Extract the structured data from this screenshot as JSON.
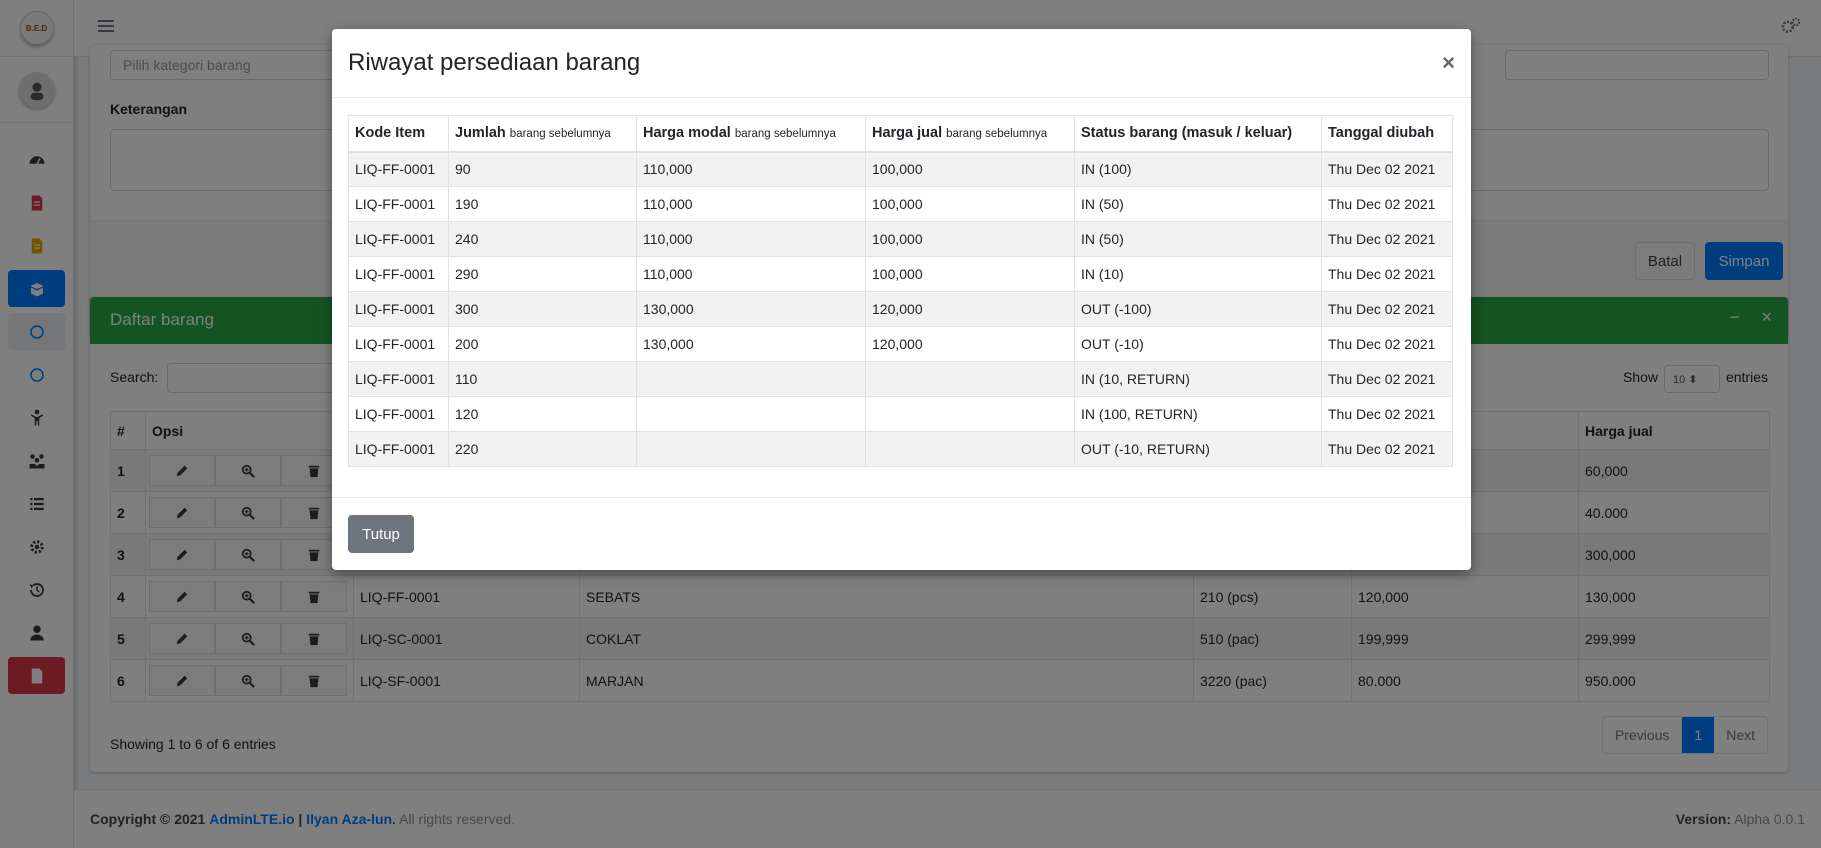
{
  "brand": {
    "logo_text": "B.E.D"
  },
  "header": {
    "menu_icon": "bars-icon",
    "settings_icon": "cogs-icon"
  },
  "form": {
    "category_placeholder": "Pilih kategori barang",
    "keterangan_label": "Keterangan",
    "batal_label": "Batal",
    "simpan_label": "Simpan"
  },
  "list_card": {
    "title": "Daftar barang",
    "search_label": "Search:",
    "show_label": "Show",
    "page_size": "10",
    "entries_label": "entries",
    "col_no": "#",
    "col_opsi": "Opsi",
    "col_harga_jual": "Harga jual",
    "rows": [
      {
        "no": "1",
        "code": "",
        "name": "",
        "stock": "",
        "modal": "",
        "jual": "60,000"
      },
      {
        "no": "2",
        "code": "",
        "name": "",
        "stock": "",
        "modal": "",
        "jual": "40.000"
      },
      {
        "no": "3",
        "code": "",
        "name": "",
        "stock": "",
        "modal": "",
        "jual": "300,000"
      },
      {
        "no": "4",
        "code": "LIQ-FF-0001",
        "name": "SEBATS",
        "stock": "210 (pcs)",
        "modal": "120,000",
        "jual": "130,000"
      },
      {
        "no": "5",
        "code": "LIQ-SC-0001",
        "name": "COKLAT",
        "stock": "510 (pac)",
        "modal": "199,999",
        "jual": "299,999"
      },
      {
        "no": "6",
        "code": "LIQ-SF-0001",
        "name": "MARJAN",
        "stock": "3220 (pac)",
        "modal": "80.000",
        "jual": "950.000"
      }
    ],
    "showing_text": "Showing 1 to 6 of 6 entries",
    "prev_label": "Previous",
    "page_label": "1",
    "next_label": "Next"
  },
  "footer": {
    "copyright": "Copyright © 2021",
    "link1": "AdminLTE.io",
    "sep": "|",
    "link2": "Ilyan Aza-lun.",
    "rights": "All rights reserved.",
    "version_label": "Version:",
    "version_value": "Alpha 0.0.1"
  },
  "modal": {
    "title": "Riwayat persediaan barang",
    "close_symbol": "×",
    "headers": {
      "kode": "Kode Item",
      "jumlah": "Jumlah",
      "jumlah_small": "barang sebelumnya",
      "modal": "Harga modal",
      "modal_small": "barang sebelumnya",
      "jual": "Harga jual",
      "jual_small": "barang sebelumnya",
      "status": "Status barang (masuk / keluar)",
      "tanggal": "Tanggal diubah"
    },
    "rows": [
      {
        "kode": "LIQ-FF-0001",
        "jumlah": "90",
        "modal": "110,000",
        "jual": "100,000",
        "status": "IN (100)",
        "tanggal": "Thu Dec 02 2021"
      },
      {
        "kode": "LIQ-FF-0001",
        "jumlah": "190",
        "modal": "110,000",
        "jual": "100,000",
        "status": "IN (50)",
        "tanggal": "Thu Dec 02 2021"
      },
      {
        "kode": "LIQ-FF-0001",
        "jumlah": "240",
        "modal": "110,000",
        "jual": "100,000",
        "status": "IN (50)",
        "tanggal": "Thu Dec 02 2021"
      },
      {
        "kode": "LIQ-FF-0001",
        "jumlah": "290",
        "modal": "110,000",
        "jual": "100,000",
        "status": "IN (10)",
        "tanggal": "Thu Dec 02 2021"
      },
      {
        "kode": "LIQ-FF-0001",
        "jumlah": "300",
        "modal": "130,000",
        "jual": "120,000",
        "status": "OUT (-100)",
        "tanggal": "Thu Dec 02 2021"
      },
      {
        "kode": "LIQ-FF-0001",
        "jumlah": "200",
        "modal": "130,000",
        "jual": "120,000",
        "status": "OUT (-10)",
        "tanggal": "Thu Dec 02 2021"
      },
      {
        "kode": "LIQ-FF-0001",
        "jumlah": "110",
        "modal": "",
        "jual": "",
        "status": "IN (10, RETURN)",
        "tanggal": "Thu Dec 02 2021"
      },
      {
        "kode": "LIQ-FF-0001",
        "jumlah": "120",
        "modal": "",
        "jual": "",
        "status": "IN (100, RETURN)",
        "tanggal": "Thu Dec 02 2021"
      },
      {
        "kode": "LIQ-FF-0001",
        "jumlah": "220",
        "modal": "",
        "jual": "",
        "status": "OUT (-10, RETURN)",
        "tanggal": "Thu Dec 02 2021"
      }
    ],
    "close_button": "Tutup"
  },
  "colors": {
    "primary": "#007bff",
    "success": "#28a745",
    "danger": "#dc3545",
    "secondary": "#6c757d"
  }
}
